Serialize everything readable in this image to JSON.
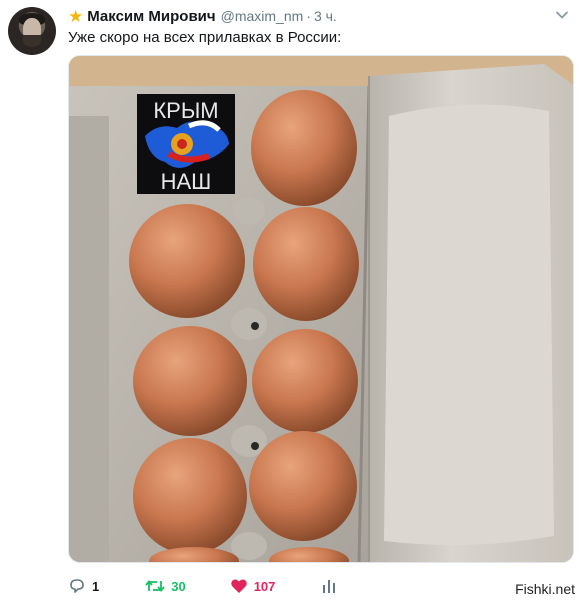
{
  "tweet": {
    "display_name": "Максим Мирович",
    "handle": "@maxim_nm",
    "separator": "·",
    "time": "3 ч.",
    "text": "Уже скоро на всех прилавках в России:",
    "badge_icon": "star-icon",
    "menu_icon": "chevron-down-icon"
  },
  "media": {
    "sticker_top": "КРЫМ",
    "sticker_bottom": "НАШ"
  },
  "actions": {
    "reply_count": "1",
    "retweet_count": "30",
    "like_count": "107",
    "reply_icon": "reply-icon",
    "retweet_icon": "retweet-icon",
    "like_icon": "heart-icon",
    "analytics_icon": "analytics-icon"
  },
  "watermark": "Fishki.net",
  "colors": {
    "accent_star": "#f5b50a",
    "retweet": "#17bf63",
    "like": "#e0245e",
    "muted": "#657786"
  }
}
